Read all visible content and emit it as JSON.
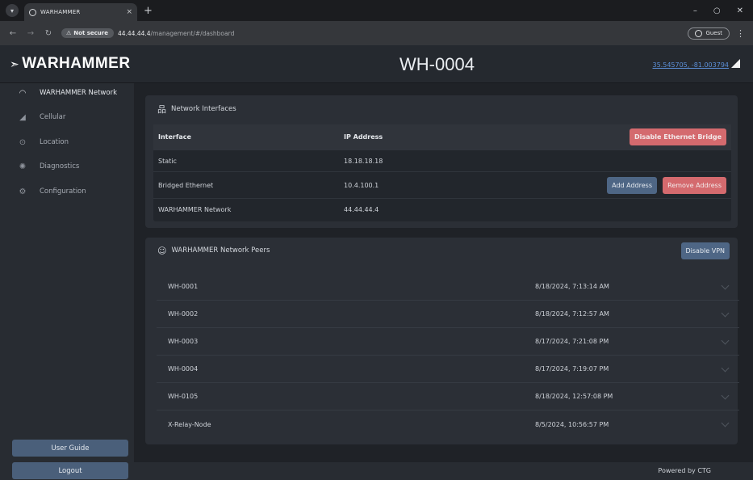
{
  "browser": {
    "tab_title": "WARHAMMER",
    "tab_close": "×",
    "new_tab": "+",
    "not_secure": "Not secure",
    "url_host": "44.44.44.4",
    "url_path": "/management/#/dashboard",
    "guest_label": "Guest"
  },
  "header": {
    "logo_text": "WARHAMMER",
    "device_title": "WH-0004",
    "coords": "35.545705, -81.003794"
  },
  "sidebar": {
    "items": [
      {
        "label": "WARHAMMER Network",
        "icon": "gauge-icon",
        "glyph": "◠"
      },
      {
        "label": "Cellular",
        "icon": "signal-icon",
        "glyph": "◢"
      },
      {
        "label": "Location",
        "icon": "location-pin-icon",
        "glyph": "⊙"
      },
      {
        "label": "Diagnostics",
        "icon": "diagnostics-icon",
        "glyph": "✺"
      },
      {
        "label": "Configuration",
        "icon": "gear-icon",
        "glyph": "⚙"
      }
    ],
    "user_guide": "User Guide",
    "logout": "Logout"
  },
  "network_interfaces": {
    "title": "Network Interfaces",
    "columns": [
      "Interface",
      "IP Address"
    ],
    "disable_bridge": "Disable Ethernet Bridge",
    "add_address": "Add Address",
    "remove_address": "Remove Address",
    "rows": [
      {
        "name": "Static",
        "ip": "18.18.18.18"
      },
      {
        "name": "Bridged Ethernet",
        "ip": "10.4.100.1"
      },
      {
        "name": "WARHAMMER Network",
        "ip": "44.44.44.4"
      }
    ]
  },
  "peers": {
    "title": "WARHAMMER Network Peers",
    "disable_vpn": "Disable VPN",
    "rows": [
      {
        "name": "WH-0001",
        "time": "8/18/2024, 7:13:14 AM"
      },
      {
        "name": "WH-0002",
        "time": "8/18/2024, 7:12:57 AM"
      },
      {
        "name": "WH-0003",
        "time": "8/17/2024, 7:21:08 PM"
      },
      {
        "name": "WH-0004",
        "time": "8/17/2024, 7:19:07 PM"
      },
      {
        "name": "WH-0105",
        "time": "8/18/2024, 12:57:08 PM"
      },
      {
        "name": "X-Relay-Node",
        "time": "8/5/2024, 10:56:57 PM"
      }
    ]
  },
  "footer": {
    "powered_by": "Powered by CTG"
  },
  "colors": {
    "accent_red": "#d46a6e",
    "accent_blue": "#4e6685",
    "link": "#5b8ed6"
  }
}
